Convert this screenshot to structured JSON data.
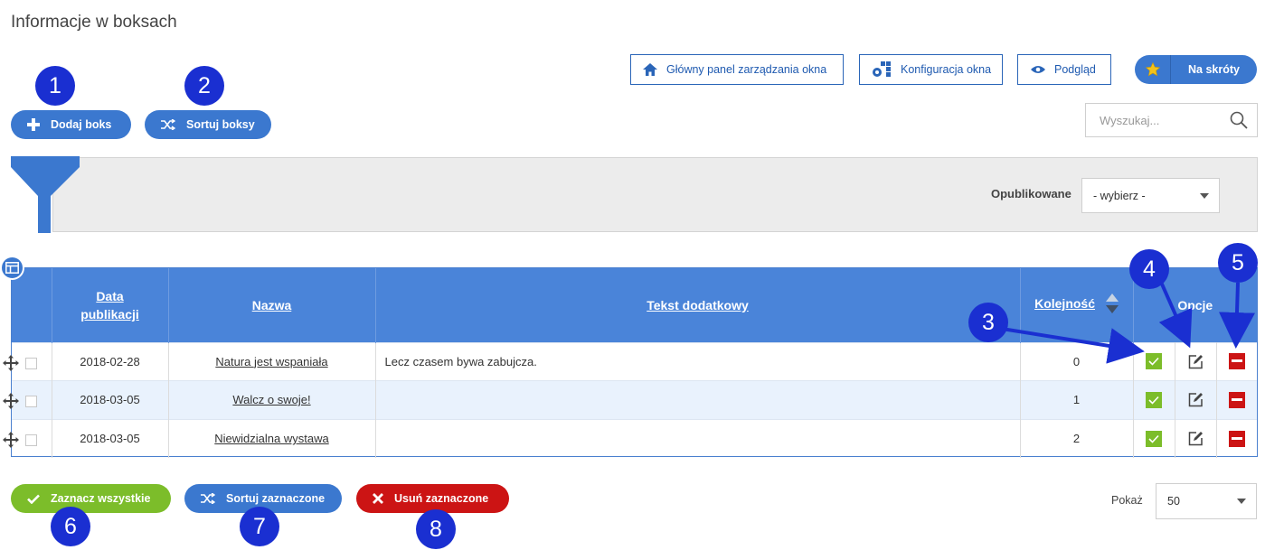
{
  "page": {
    "title": "Informacje w boksach"
  },
  "toolbar": {
    "add_label": "Dodaj boks",
    "sort_label": "Sortuj boksy",
    "main_panel_label": "Główny panel zarządzania okna",
    "config_label": "Konfiguracja okna",
    "preview_label": "Podgląd",
    "shortcuts_label": "Na skróty"
  },
  "search": {
    "placeholder": "Wyszukaj..."
  },
  "filter": {
    "published_label": "Opublikowane",
    "published_value": "- wybierz -"
  },
  "table": {
    "headers": {
      "date": "Data publikacji",
      "name": "Nazwa",
      "extra": "Tekst dodatkowy",
      "order": "Kolejność",
      "options": "Opcje"
    },
    "rows": [
      {
        "date": "2018-02-28",
        "name": "Natura jest wspaniała",
        "extra": "Lecz czasem bywa zabujcza.",
        "order": "0"
      },
      {
        "date": "2018-03-05",
        "name": "Walcz o swoje!",
        "extra": "",
        "order": "1"
      },
      {
        "date": "2018-03-05",
        "name": "Niewidzialna wystawa",
        "extra": "",
        "order": "2"
      }
    ]
  },
  "bottom": {
    "select_all_label": "Zaznacz wszystkie",
    "sort_selected_label": "Sortuj zaznaczone",
    "delete_selected_label": "Usuń zaznaczone",
    "show_label": "Pokaż",
    "show_value": "50"
  },
  "annotations": [
    "1",
    "2",
    "3",
    "4",
    "5",
    "6",
    "7",
    "8"
  ],
  "colors": {
    "primary": "#3b78cf",
    "header": "#4a84d9",
    "green": "#7cbd2a",
    "red": "#cc1414",
    "badge": "#1a2fd1"
  }
}
